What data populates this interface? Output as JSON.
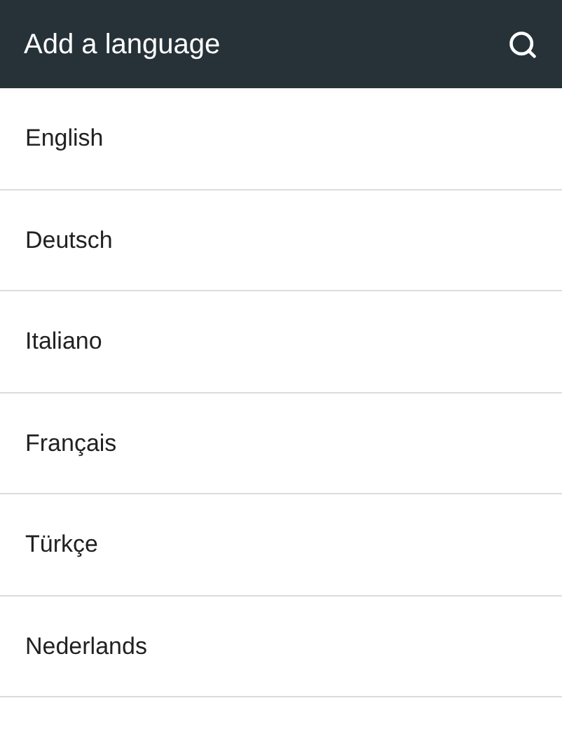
{
  "app_bar": {
    "title": "Add a language"
  },
  "languages": [
    {
      "name": "English"
    },
    {
      "name": "Deutsch"
    },
    {
      "name": "Italiano"
    },
    {
      "name": "Français"
    },
    {
      "name": "Türkçe"
    },
    {
      "name": "Nederlands"
    }
  ]
}
